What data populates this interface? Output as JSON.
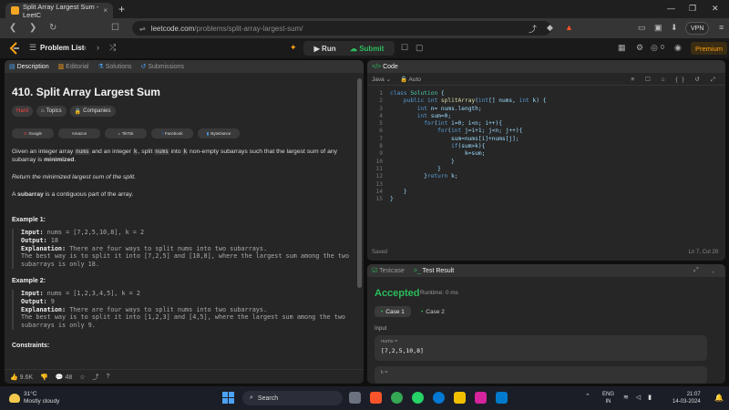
{
  "browser": {
    "tab_title": "Split Array Largest Sum - LeetC",
    "tab_close": "×",
    "new_tab": "+",
    "url_host": "leetcode.com",
    "url_path": "/problems/split-array-largest-sum/",
    "vpn_label": "VPN"
  },
  "lcnav": {
    "problem_list": "Problem List",
    "run": "Run",
    "submit": "Submit",
    "coins": "0",
    "premium": "Premium"
  },
  "left": {
    "tabs": [
      "Description",
      "Editorial",
      "Solutions",
      "Submissions"
    ],
    "title": "410. Split Array Largest Sum",
    "difficulty": "Hard",
    "topics": "Topics",
    "companies": "Companies",
    "company_tags": [
      "Google",
      "Amazon",
      "TikTok",
      "Facebook",
      "ByteDance"
    ],
    "para1_a": "Given an integer array ",
    "para1_code1": "nums",
    "para1_b": " and an integer ",
    "para1_code2": "k",
    "para1_c": ", split ",
    "para1_code3": "nums",
    "para1_d": " into ",
    "para1_code4": "k",
    "para1_e": " non-empty subarrays such that the largest sum of any subarray is ",
    "para1_bold": "minimized",
    "para1_f": ".",
    "para2": "Return the minimized largest sum of the split.",
    "para3_a": "A ",
    "para3_bold": "subarray",
    "para3_b": " is a contiguous part of the array.",
    "ex1_title": "Example 1:",
    "ex1_input_label": "Input:",
    "ex1_input": " nums = [7,2,5,10,8], k = 2",
    "ex1_output_label": "Output:",
    "ex1_output": " 18",
    "ex1_expl_label": "Explanation:",
    "ex1_expl": " There are four ways to split nums into two subarrays.",
    "ex1_expl2": "The best way is to split it into [7,2,5] and [10,8], where the largest sum among the two",
    "ex1_expl3": "subarrays is only 18.",
    "ex2_title": "Example 2:",
    "ex2_input_label": "Input:",
    "ex2_input": " nums = [1,2,3,4,5], k = 2",
    "ex2_output_label": "Output:",
    "ex2_output": " 9",
    "ex2_expl_label": "Explanation:",
    "ex2_expl": " There are four ways to split nums into two subarrays.",
    "ex2_expl2": "The best way is to split it into [1,2,3] and [4,5], where the largest sum among the two",
    "ex2_expl3": "subarrays is only 9.",
    "constraints": "Constraints:",
    "likes": "9.6K",
    "comments": "48"
  },
  "code": {
    "tab": "Code",
    "lang": "Java",
    "auto": "Auto",
    "saved": "Saved",
    "position": "Ln 7, Col 29",
    "lines": [
      "class Solution {",
      "    public int splitArray(int[] nums, int k) {",
      "        int n= nums.length;",
      "        int sum=0;",
      "          for(int i=0; i<n; i++){",
      "              for(int j=i+1; j<n; j++){",
      "                  sum=nums[i]+nums[j];",
      "                  if(sum>k){",
      "                      k=sum;",
      "                  }",
      "              }",
      "          }return k;",
      "    ",
      "    }",
      "}"
    ]
  },
  "result": {
    "testcase_tab": "Testcase",
    "result_tab": "Test Result",
    "status": "Accepted",
    "runtime": "Runtime: 0 ms",
    "case1": "Case 1",
    "case2": "Case 2",
    "input_label": "Input",
    "nums_label": "nums =",
    "nums_value": "[7,2,5,10,8]",
    "k_label": "k ="
  },
  "taskbar": {
    "temp": "31°C",
    "weather": "Mostly cloudy",
    "search": "Search",
    "lang1": "ENG",
    "lang2": "IN",
    "time": "21:07",
    "date": "14-03-2024"
  },
  "colors": {
    "accepted": "#2cbb5d",
    "hard": "#ef4743",
    "premium": "#ffa116"
  }
}
